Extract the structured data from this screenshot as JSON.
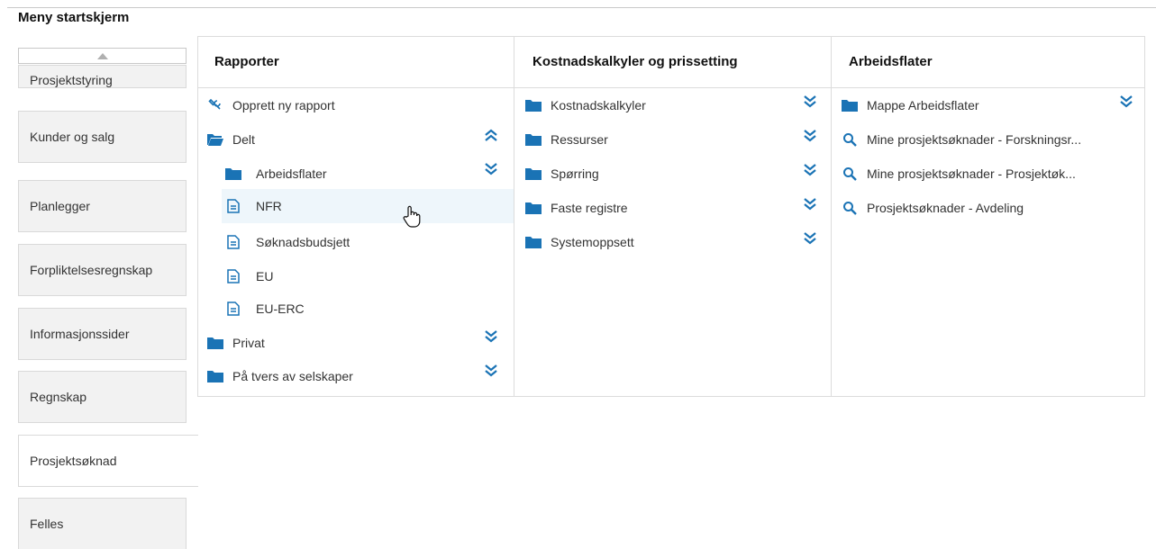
{
  "page_title": "Meny startskjerm",
  "colors": {
    "accent": "#1a73b5",
    "hover": "#eef6fb"
  },
  "nav": {
    "items": [
      {
        "label": "Prosjektstyring"
      },
      {
        "label": "Kunder og salg"
      },
      {
        "label": "Planlegger"
      },
      {
        "label": "Forpliktelsesregnskap"
      },
      {
        "label": "Informasjonssider"
      },
      {
        "label": "Regnskap"
      },
      {
        "label": "Prosjektsøknad"
      },
      {
        "label": "Felles"
      }
    ]
  },
  "columns": {
    "rapporter": {
      "title": "Rapporter",
      "items": [
        {
          "label": "Opprett ny rapport",
          "icon": "wrench-icon"
        },
        {
          "label": "Delt",
          "icon": "folder-open-icon",
          "chevron": "up"
        },
        {
          "label": "Arbeidsflater",
          "icon": "folder-icon",
          "chevron": "down"
        },
        {
          "label": "NFR",
          "icon": "document-icon"
        },
        {
          "label": "Søknadsbudsjett",
          "icon": "document-icon"
        },
        {
          "label": "EU",
          "icon": "document-icon"
        },
        {
          "label": "EU-ERC",
          "icon": "document-icon"
        },
        {
          "label": "Privat",
          "icon": "folder-icon",
          "chevron": "down"
        },
        {
          "label": "På tvers av selskaper",
          "icon": "folder-icon",
          "chevron": "down"
        }
      ]
    },
    "kostnad": {
      "title": "Kostnadskalkyler og prissetting",
      "items": [
        {
          "label": "Kostnadskalkyler",
          "icon": "folder-icon",
          "chevron": "down"
        },
        {
          "label": "Ressurser",
          "icon": "folder-icon",
          "chevron": "down"
        },
        {
          "label": "Spørring",
          "icon": "folder-icon",
          "chevron": "down"
        },
        {
          "label": "Faste registre",
          "icon": "folder-icon",
          "chevron": "down"
        },
        {
          "label": "Systemoppsett",
          "icon": "folder-icon",
          "chevron": "down"
        }
      ]
    },
    "arbeidsflater": {
      "title": "Arbeidsflater",
      "items": [
        {
          "label": "Mappe Arbeidsflater",
          "icon": "folder-icon",
          "chevron": "down"
        },
        {
          "label": "Mine prosjektsøknader - Forskningsr...",
          "icon": "search-icon"
        },
        {
          "label": "Mine prosjektsøknader - Prosjektøk...",
          "icon": "search-icon"
        },
        {
          "label": "Prosjektsøknader - Avdeling",
          "icon": "search-icon"
        }
      ]
    }
  }
}
